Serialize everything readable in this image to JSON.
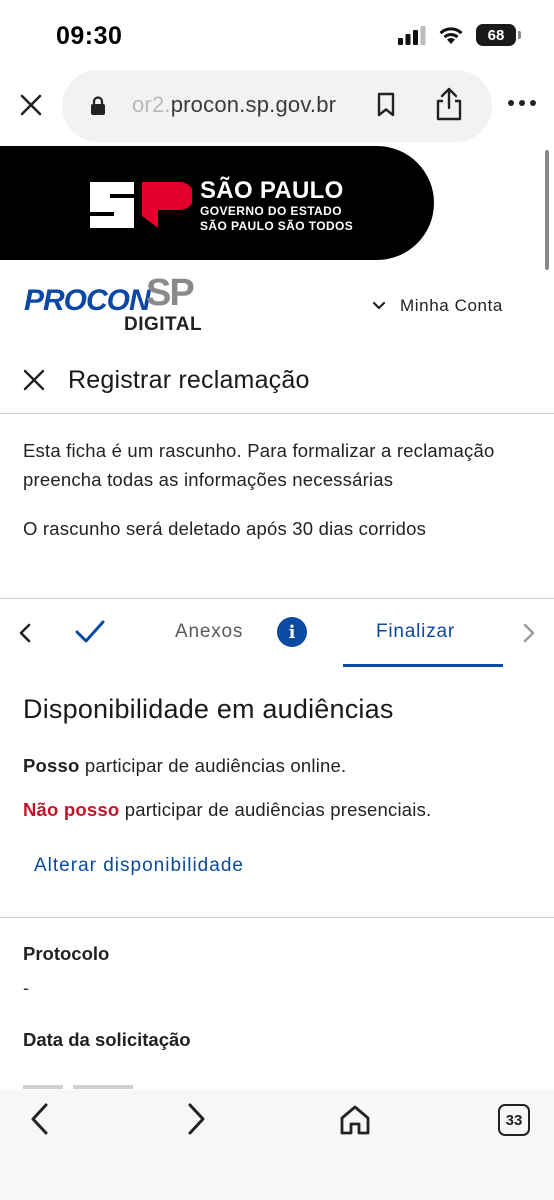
{
  "status": {
    "time": "09:30",
    "battery": "68"
  },
  "browser": {
    "url_prefix": "or2.",
    "url_domain": "procon.sp.gov.br",
    "tabs_count": "33"
  },
  "gov_banner": {
    "line1": "SÃO PAULO",
    "line2": "GOVERNO DO ESTADO",
    "line3": "SÃO PAULO SÃO TODOS"
  },
  "procon": {
    "word": "PROCON",
    "sp": "SP",
    "digital": "DIGITAL"
  },
  "header": {
    "account_label": "Minha Conta"
  },
  "page": {
    "title": "Registrar reclamação"
  },
  "info": {
    "draft_notice": "Esta ficha é um rascunho. Para formalizar a reclamação preencha todas as informações necessárias",
    "deletion_notice": "O rascunho será deletado após 30 dias corridos"
  },
  "stepper": {
    "step_anexos": "Anexos",
    "info_symbol": "i",
    "step_finalizar": "Finalizar"
  },
  "availability": {
    "title": "Disponibilidade em audiências",
    "online_strong": "Posso",
    "online_rest": " participar de audiências online.",
    "presencial_strong": "Não posso",
    "presencial_rest": " participar de audiências presenciais.",
    "change_link": "Alterar disponibilidade"
  },
  "details": {
    "protocolo_label": "Protocolo",
    "protocolo_value": "-",
    "data_label": "Data da solicitação"
  },
  "colors": {
    "primary": "#0a4aa0",
    "negative": "#c0142a",
    "banner": "#000000"
  }
}
